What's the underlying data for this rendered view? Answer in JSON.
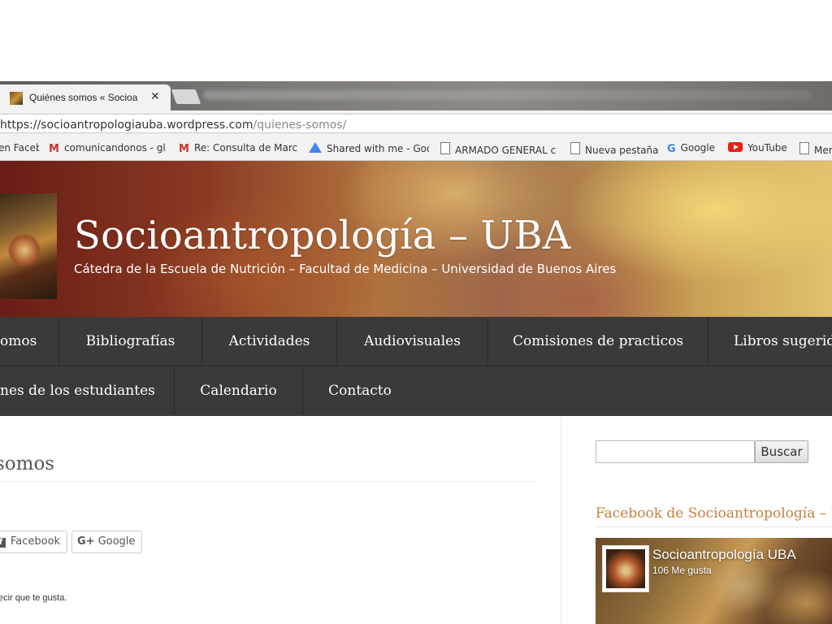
{
  "browser": {
    "tab_title": "Quiénes somos « Socioa",
    "tab_close": "✕",
    "url_host": "https://socioantropologiauba.wordpress.com",
    "url_path": "/quienes-somos/"
  },
  "bookmarks": [
    {
      "label": "en Faceb",
      "icon": "page-icon"
    },
    {
      "label": "comunicandonos - gl",
      "icon": "gmail-icon"
    },
    {
      "label": "Re: Consulta de Marc",
      "icon": "gmail-icon"
    },
    {
      "label": "Shared with me - Goo",
      "icon": "drive-icon"
    },
    {
      "label": "ARMADO GENERAL c",
      "icon": "page-icon"
    },
    {
      "label": "Nueva pestaña",
      "icon": "page-icon"
    },
    {
      "label": "Google",
      "icon": "g-icon"
    },
    {
      "label": "YouTube",
      "icon": "youtube-icon"
    },
    {
      "label": "Mer",
      "icon": "page-icon"
    }
  ],
  "site": {
    "title": "Socioantropología – UBA",
    "description": "Cátedra de la Escuela de Nutrición – Facultad de Medicina – Universidad de Buenos Aires"
  },
  "nav": {
    "row1": [
      "omos",
      "Bibliografías",
      "Actividades",
      "Audiovisuales",
      "Comisiones de practicos",
      "Libros sugerid"
    ],
    "row2": [
      "nes de los estudiantes",
      "Calendario",
      "Contacto"
    ]
  },
  "content": {
    "heading": "somos",
    "share_facebook": "Facebook",
    "share_google": "Google",
    "like_text": "ecir que te gusta."
  },
  "sidebar": {
    "search_placeholder": "",
    "search_button": "Buscar",
    "widget_title": "Facebook de Socioantropología – UBA",
    "fb_page_name": "Socioantropología UBA",
    "fb_likes": "106 Me gusta"
  },
  "colors": {
    "nav_bg": "#3a3a3a",
    "widget_title": "#c5813c"
  }
}
